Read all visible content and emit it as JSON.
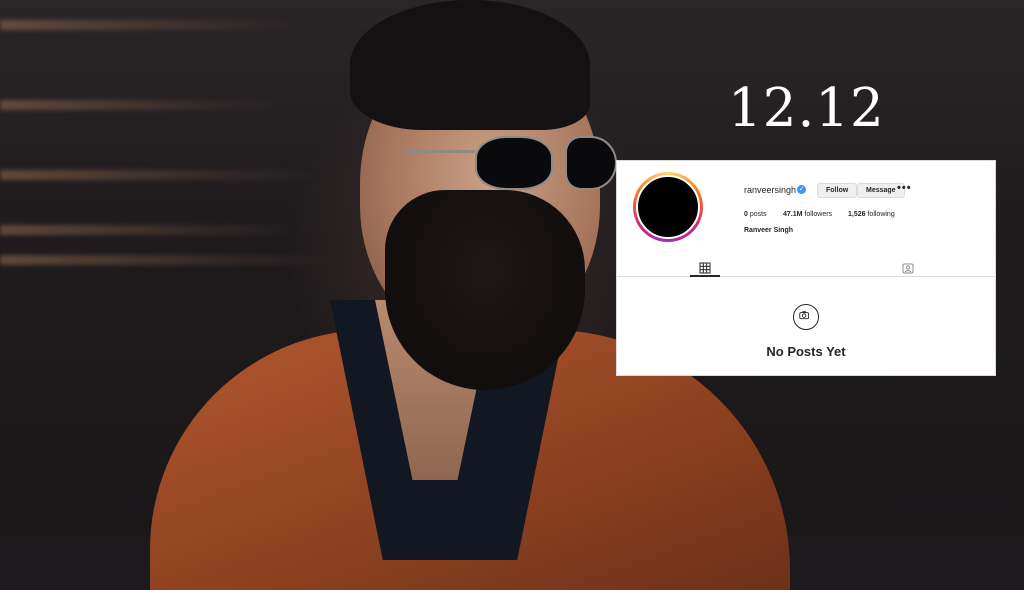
{
  "overlay": {
    "date_text": "12.12"
  },
  "profile": {
    "username": "ranveersingh",
    "verified": true,
    "follow_label": "Follow",
    "message_label": "Message",
    "more_label": "•••",
    "stats": {
      "posts_count": "0",
      "posts_label": "posts",
      "followers_count": "47.1M",
      "followers_label": "followers",
      "following_count": "1,526",
      "following_label": "following"
    },
    "full_name": "Ranveer Singh",
    "tabs": {
      "active": "posts-grid",
      "icons": [
        "grid-icon",
        "tagged-icon"
      ]
    },
    "empty_state": {
      "icon": "camera-icon",
      "text": "No Posts Yet"
    }
  },
  "colors": {
    "verified_blue": "#3897f0",
    "text_dark": "#262626",
    "border": "#dbdbdb",
    "coat_orange": "#a04b26"
  }
}
